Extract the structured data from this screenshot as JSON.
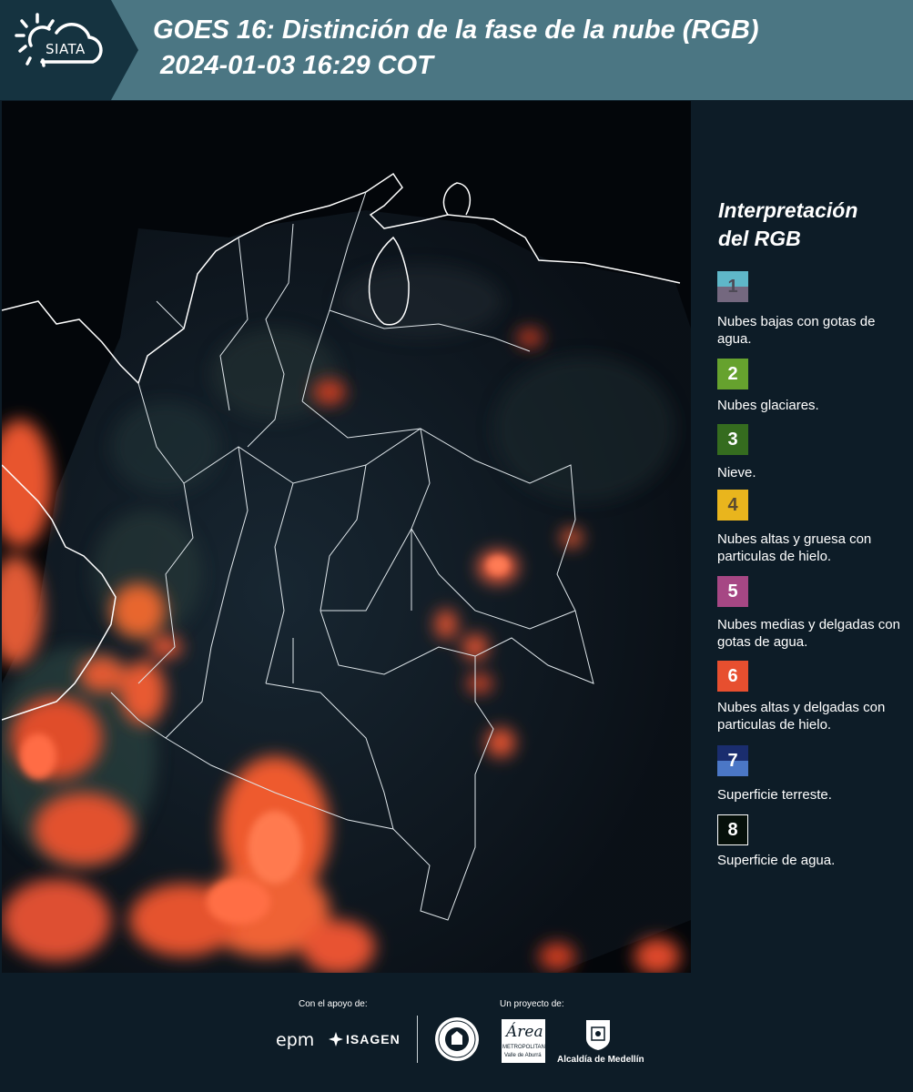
{
  "header": {
    "logo_text": "SIATA",
    "title": "GOES 16: Distinción de la fase de la nube (RGB)",
    "subtitle": "2024-01-03 16:29 COT"
  },
  "legend": {
    "title": "Interpretación\ndel RGB",
    "items": [
      {
        "number": "1",
        "label": "Nubes bajas con gotas de agua.",
        "colors": [
          "#5fb7c8",
          "#74687f"
        ],
        "number_color": "#4e4a56"
      },
      {
        "number": "2",
        "label": "Nubes glaciares.",
        "colors": [
          "#66a22e"
        ],
        "number_color": "#ffffff"
      },
      {
        "number": "3",
        "label": "Nieve.",
        "colors": [
          "#356c1f"
        ],
        "number_color": "#ffffff"
      },
      {
        "number": "4",
        "label": "Nubes altas y gruesa con particulas de hielo.",
        "colors": [
          "#e9b51d"
        ],
        "number_color": "#5a4a30"
      },
      {
        "number": "5",
        "label": "Nubes medias y delgadas con gotas de agua.",
        "colors": [
          "#a64784"
        ],
        "number_color": "#ffffff"
      },
      {
        "number": "6",
        "label": "Nubes altas y delgadas con particulas de hielo.",
        "colors": [
          "#e74f2f"
        ],
        "number_color": "#ffffff"
      },
      {
        "number": "7",
        "label": "Superficie terreste.",
        "colors": [
          "#1a2d6e",
          "#4b77c6"
        ],
        "number_color": "#ffffff"
      },
      {
        "number": "8",
        "label": "Superficie de agua.",
        "colors": [
          "#06100a"
        ],
        "number_color": "#ffffff",
        "bordered": true
      }
    ]
  },
  "footer": {
    "support_caption": "Con el apoyo de:",
    "project_caption": "Un proyecto de:",
    "logos": {
      "epm": "epm",
      "isagen": "ISAGEN",
      "area_main": "Área",
      "area_sub": "METROPOLITANA",
      "area_sub2": "Valle de Aburrá",
      "alcaldia": "Alcaldía de Medellín"
    }
  }
}
